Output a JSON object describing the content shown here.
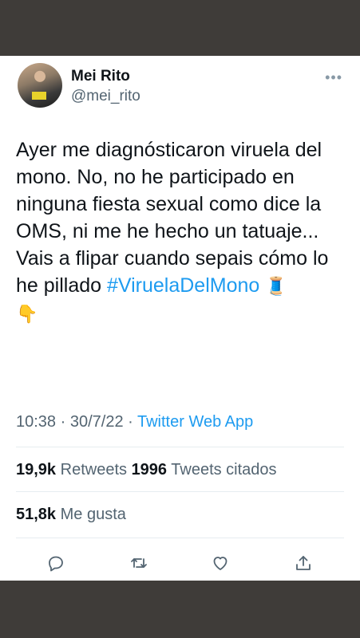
{
  "user": {
    "name": "Mei Rito",
    "handle": "@mei_rito"
  },
  "tweet": {
    "text_before": "Ayer me diagnósticaron viruela del mono. No, no he participado en ninguna fiesta sexual como dice la OMS, ni me he hecho un tatuaje... Vais a flipar cuando sepais cómo lo he pillado ",
    "hashtag": "#ViruelaDelMono",
    "emoji_1": "🧵",
    "emoji_2": "👇"
  },
  "meta": {
    "time": "10:38",
    "sep1": " · ",
    "date": "30/7/22",
    "sep2": " · ",
    "source": "Twitter Web App"
  },
  "stats": {
    "retweets_count": "19,9k",
    "retweets_label": "Retweets",
    "quotes_count": "1996",
    "quotes_label": "Tweets citados",
    "likes_count": "51,8k",
    "likes_label": "Me gusta"
  },
  "icons": {
    "more": "more-icon",
    "reply": "reply-icon",
    "retweet": "retweet-icon",
    "like": "like-icon",
    "share": "share-icon"
  },
  "colors": {
    "background": "#3f3c39",
    "card": "#ffffff",
    "accent": "#1d9bf0",
    "secondary_text": "#536471"
  }
}
